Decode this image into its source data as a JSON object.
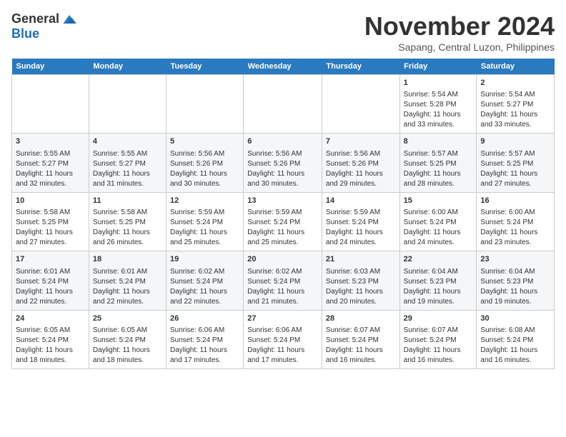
{
  "header": {
    "logo_general": "General",
    "logo_blue": "Blue",
    "month_title": "November 2024",
    "location": "Sapang, Central Luzon, Philippines"
  },
  "weekdays": [
    "Sunday",
    "Monday",
    "Tuesday",
    "Wednesday",
    "Thursday",
    "Friday",
    "Saturday"
  ],
  "weeks": [
    [
      {
        "day": "",
        "info": ""
      },
      {
        "day": "",
        "info": ""
      },
      {
        "day": "",
        "info": ""
      },
      {
        "day": "",
        "info": ""
      },
      {
        "day": "",
        "info": ""
      },
      {
        "day": "1",
        "info": "Sunrise: 5:54 AM\nSunset: 5:28 PM\nDaylight: 11 hours and 33 minutes."
      },
      {
        "day": "2",
        "info": "Sunrise: 5:54 AM\nSunset: 5:27 PM\nDaylight: 11 hours and 33 minutes."
      }
    ],
    [
      {
        "day": "3",
        "info": "Sunrise: 5:55 AM\nSunset: 5:27 PM\nDaylight: 11 hours and 32 minutes."
      },
      {
        "day": "4",
        "info": "Sunrise: 5:55 AM\nSunset: 5:27 PM\nDaylight: 11 hours and 31 minutes."
      },
      {
        "day": "5",
        "info": "Sunrise: 5:56 AM\nSunset: 5:26 PM\nDaylight: 11 hours and 30 minutes."
      },
      {
        "day": "6",
        "info": "Sunrise: 5:56 AM\nSunset: 5:26 PM\nDaylight: 11 hours and 30 minutes."
      },
      {
        "day": "7",
        "info": "Sunrise: 5:56 AM\nSunset: 5:26 PM\nDaylight: 11 hours and 29 minutes."
      },
      {
        "day": "8",
        "info": "Sunrise: 5:57 AM\nSunset: 5:25 PM\nDaylight: 11 hours and 28 minutes."
      },
      {
        "day": "9",
        "info": "Sunrise: 5:57 AM\nSunset: 5:25 PM\nDaylight: 11 hours and 27 minutes."
      }
    ],
    [
      {
        "day": "10",
        "info": "Sunrise: 5:58 AM\nSunset: 5:25 PM\nDaylight: 11 hours and 27 minutes."
      },
      {
        "day": "11",
        "info": "Sunrise: 5:58 AM\nSunset: 5:25 PM\nDaylight: 11 hours and 26 minutes."
      },
      {
        "day": "12",
        "info": "Sunrise: 5:59 AM\nSunset: 5:24 PM\nDaylight: 11 hours and 25 minutes."
      },
      {
        "day": "13",
        "info": "Sunrise: 5:59 AM\nSunset: 5:24 PM\nDaylight: 11 hours and 25 minutes."
      },
      {
        "day": "14",
        "info": "Sunrise: 5:59 AM\nSunset: 5:24 PM\nDaylight: 11 hours and 24 minutes."
      },
      {
        "day": "15",
        "info": "Sunrise: 6:00 AM\nSunset: 5:24 PM\nDaylight: 11 hours and 24 minutes."
      },
      {
        "day": "16",
        "info": "Sunrise: 6:00 AM\nSunset: 5:24 PM\nDaylight: 11 hours and 23 minutes."
      }
    ],
    [
      {
        "day": "17",
        "info": "Sunrise: 6:01 AM\nSunset: 5:24 PM\nDaylight: 11 hours and 22 minutes."
      },
      {
        "day": "18",
        "info": "Sunrise: 6:01 AM\nSunset: 5:24 PM\nDaylight: 11 hours and 22 minutes."
      },
      {
        "day": "19",
        "info": "Sunrise: 6:02 AM\nSunset: 5:24 PM\nDaylight: 11 hours and 22 minutes."
      },
      {
        "day": "20",
        "info": "Sunrise: 6:02 AM\nSunset: 5:24 PM\nDaylight: 11 hours and 21 minutes."
      },
      {
        "day": "21",
        "info": "Sunrise: 6:03 AM\nSunset: 5:23 PM\nDaylight: 11 hours and 20 minutes."
      },
      {
        "day": "22",
        "info": "Sunrise: 6:04 AM\nSunset: 5:23 PM\nDaylight: 11 hours and 19 minutes."
      },
      {
        "day": "23",
        "info": "Sunrise: 6:04 AM\nSunset: 5:23 PM\nDaylight: 11 hours and 19 minutes."
      }
    ],
    [
      {
        "day": "24",
        "info": "Sunrise: 6:05 AM\nSunset: 5:24 PM\nDaylight: 11 hours and 18 minutes."
      },
      {
        "day": "25",
        "info": "Sunrise: 6:05 AM\nSunset: 5:24 PM\nDaylight: 11 hours and 18 minutes."
      },
      {
        "day": "26",
        "info": "Sunrise: 6:06 AM\nSunset: 5:24 PM\nDaylight: 11 hours and 17 minutes."
      },
      {
        "day": "27",
        "info": "Sunrise: 6:06 AM\nSunset: 5:24 PM\nDaylight: 11 hours and 17 minutes."
      },
      {
        "day": "28",
        "info": "Sunrise: 6:07 AM\nSunset: 5:24 PM\nDaylight: 11 hours and 16 minutes."
      },
      {
        "day": "29",
        "info": "Sunrise: 6:07 AM\nSunset: 5:24 PM\nDaylight: 11 hours and 16 minutes."
      },
      {
        "day": "30",
        "info": "Sunrise: 6:08 AM\nSunset: 5:24 PM\nDaylight: 11 hours and 16 minutes."
      }
    ]
  ]
}
